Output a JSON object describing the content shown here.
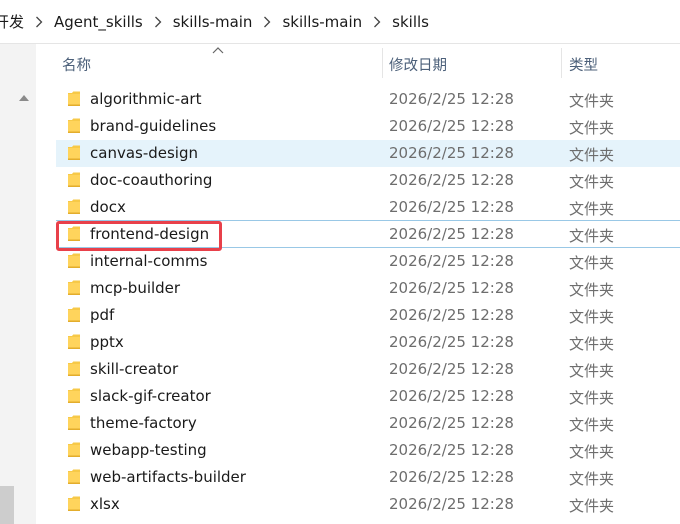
{
  "breadcrumb": {
    "items": [
      "开发",
      "Agent_skills",
      "skills-main",
      "skills-main",
      "skills"
    ]
  },
  "columns": {
    "name": "名称",
    "date": "修改日期",
    "type": "类型"
  },
  "files": [
    {
      "name": "algorithmic-art",
      "date": "2026/2/25 12:28",
      "type": "文件夹"
    },
    {
      "name": "brand-guidelines",
      "date": "2026/2/25 12:28",
      "type": "文件夹"
    },
    {
      "name": "canvas-design",
      "date": "2026/2/25 12:28",
      "type": "文件夹"
    },
    {
      "name": "doc-coauthoring",
      "date": "2026/2/25 12:28",
      "type": "文件夹"
    },
    {
      "name": "docx",
      "date": "2026/2/25 12:28",
      "type": "文件夹"
    },
    {
      "name": "frontend-design",
      "date": "2026/2/25 12:28",
      "type": "文件夹"
    },
    {
      "name": "internal-comms",
      "date": "2026/2/25 12:28",
      "type": "文件夹"
    },
    {
      "name": "mcp-builder",
      "date": "2026/2/25 12:28",
      "type": "文件夹"
    },
    {
      "name": "pdf",
      "date": "2026/2/25 12:28",
      "type": "文件夹"
    },
    {
      "name": "pptx",
      "date": "2026/2/25 12:28",
      "type": "文件夹"
    },
    {
      "name": "skill-creator",
      "date": "2026/2/25 12:28",
      "type": "文件夹"
    },
    {
      "name": "slack-gif-creator",
      "date": "2026/2/25 12:28",
      "type": "文件夹"
    },
    {
      "name": "theme-factory",
      "date": "2026/2/25 12:28",
      "type": "文件夹"
    },
    {
      "name": "webapp-testing",
      "date": "2026/2/25 12:28",
      "type": "文件夹"
    },
    {
      "name": "web-artifacts-builder",
      "date": "2026/2/25 12:28",
      "type": "文件夹"
    },
    {
      "name": "xlsx",
      "date": "2026/2/25 12:28",
      "type": "文件夹"
    }
  ],
  "colors": {
    "hover_row": "#e5f3fb",
    "highlight": "#e8404a",
    "folder": "#f7c948"
  },
  "icons": {
    "folder": "folder-icon",
    "separator": "chevron-right-icon",
    "sort": "sort-ascending-icon"
  }
}
